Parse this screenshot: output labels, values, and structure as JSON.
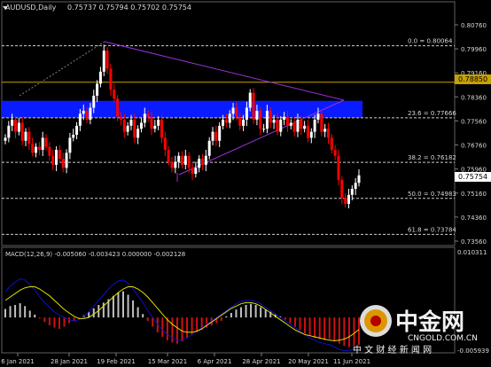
{
  "header": {
    "symbol": "AUDUSD,Daily",
    "ohlc": "0.75737 0.75794 0.75702 0.75754"
  },
  "price_scale": {
    "labels": [
      "0.80760",
      "0.79960",
      "0.79160",
      "0.78360",
      "0.77560",
      "0.76760",
      "0.75960",
      "0.75160",
      "0.74360",
      "0.73560"
    ],
    "highlight_gold": "0.78850",
    "highlight_current": "0.75754"
  },
  "fib_levels": [
    {
      "label": "0.0 = 0.80064",
      "value": 0.80064
    },
    {
      "label": "23.6 = 0.77666",
      "value": 0.77666
    },
    {
      "label": "38.2 = 0.76182",
      "value": 0.76182
    },
    {
      "label": "50.0 = 0.74983",
      "value": 0.74983
    },
    {
      "label": "61.8 = 0.73784",
      "value": 0.73784
    }
  ],
  "macd": {
    "label": "MACD(12,26,9) -0.005060 -0.003423 0.000000 -0.002128",
    "scale_top": "0.010311",
    "scale_bottom": "-0.005939"
  },
  "date_axis": [
    "6 Jan 2021",
    "28 Jan 2021",
    "19 Feb 2021",
    "15 Mar 2021",
    "6 Apr 2021",
    "28 Apr 2021",
    "20 May 2021",
    "11 Jun 2021"
  ],
  "watermark": {
    "brand": "中金网",
    "domain": "CNGOLD.COM.CN",
    "tagline": "中 文 财 经 新 闻 网"
  },
  "colors": {
    "background": "#000000",
    "bull": "#ffffff",
    "bear": "#ff0000",
    "zone": "#0a1cff",
    "triangle": "#9b30d8",
    "gold_line": "#c8a000",
    "macd_hist": "#c0c0c0",
    "macd_hist_neg": "#d01010",
    "macd_line": "#1010c8",
    "signal_line": "#e0e000"
  },
  "chart_data": {
    "type": "candlestick",
    "instrument": "AUDUSD",
    "timeframe": "Daily",
    "last_price": 0.75754,
    "ylim": [
      0.7325,
      0.8105
    ],
    "reference_lines": [
      0.7885,
      0.80064,
      0.77666,
      0.76182,
      0.74983,
      0.73784
    ],
    "zone": [
      0.7766,
      0.7823
    ],
    "closes": [
      0.77,
      0.774,
      0.776,
      0.772,
      0.775,
      0.769,
      0.772,
      0.768,
      0.765,
      0.767,
      0.766,
      0.77,
      0.767,
      0.764,
      0.761,
      0.766,
      0.763,
      0.76,
      0.765,
      0.77,
      0.771,
      0.774,
      0.778,
      0.779,
      0.776,
      0.78,
      0.784,
      0.788,
      0.792,
      0.799,
      0.793,
      0.786,
      0.783,
      0.777,
      0.776,
      0.772,
      0.774,
      0.776,
      0.77,
      0.773,
      0.775,
      0.778,
      0.777,
      0.773,
      0.774,
      0.776,
      0.77,
      0.766,
      0.762,
      0.76,
      0.762,
      0.764,
      0.761,
      0.764,
      0.76,
      0.758,
      0.76,
      0.763,
      0.761,
      0.764,
      0.769,
      0.772,
      0.769,
      0.774,
      0.776,
      0.775,
      0.778,
      0.78,
      0.777,
      0.774,
      0.776,
      0.78,
      0.785,
      0.776,
      0.779,
      0.773,
      0.773,
      0.779,
      0.775,
      0.776,
      0.772,
      0.776,
      0.777,
      0.774,
      0.775,
      0.772,
      0.776,
      0.773,
      0.774,
      0.77,
      0.772,
      0.776,
      0.778,
      0.772,
      0.773,
      0.77,
      0.766,
      0.764,
      0.756,
      0.75,
      0.748,
      0.751,
      0.753,
      0.755,
      0.7575
    ],
    "macd_hist": [
      0.0015,
      0.002,
      0.0022,
      0.0025,
      0.002,
      0.0012,
      0.0005,
      -0.0002,
      -0.0008,
      -0.0014,
      -0.0018,
      -0.002,
      -0.0016,
      -0.001,
      -0.0006,
      -0.0002,
      0.0004,
      0.001,
      0.0016,
      0.0022,
      0.0026,
      0.0032,
      0.0038,
      0.0044,
      0.0046,
      0.004,
      0.003,
      0.0018,
      0.0006,
      -0.0006,
      -0.0016,
      -0.0026,
      -0.0034,
      -0.004,
      -0.0044,
      -0.0046,
      -0.0042,
      -0.0036,
      -0.003,
      -0.0026,
      -0.0022,
      -0.0018,
      -0.0014,
      -0.001,
      -0.0006,
      0.0002,
      0.0008,
      0.0014,
      0.0018,
      0.0022,
      0.0024,
      0.0022,
      0.0018,
      0.0014,
      0.001,
      0.0006,
      0.0002,
      -0.0004,
      -0.001,
      -0.0016,
      -0.0022,
      -0.0028,
      -0.0032,
      -0.0036,
      -0.0038,
      -0.004,
      -0.0038,
      -0.0042,
      -0.0046,
      -0.005,
      -0.0052,
      -0.005,
      -0.0048
    ],
    "macd_line": [
      0.0045,
      0.0055,
      0.0062,
      0.0068,
      0.0066,
      0.0058,
      0.0048,
      0.0036,
      0.0026,
      0.0018,
      0.001,
      0.0004,
      0.0,
      -0.0004,
      -0.0006,
      -0.0004,
      0.0002,
      0.001,
      0.002,
      0.003,
      0.004,
      0.005,
      0.0058,
      0.0064,
      0.0066,
      0.006,
      0.005,
      0.0038,
      0.0026,
      0.0012,
      0.0,
      -0.0012,
      -0.0022,
      -0.003,
      -0.0036,
      -0.004,
      -0.004,
      -0.0036,
      -0.003,
      -0.0024,
      -0.0018,
      -0.0012,
      -0.0006,
      0.0,
      0.0006,
      0.0012,
      0.0018,
      0.0024,
      0.0028,
      0.003,
      0.003,
      0.0028,
      0.0024,
      0.0018,
      0.0012,
      0.0006,
      0.0,
      -0.0006,
      -0.0012,
      -0.0018,
      -0.0024,
      -0.003,
      -0.0036,
      -0.004,
      -0.0044,
      -0.0046,
      -0.0048,
      -0.0052,
      -0.0056,
      -0.0058,
      -0.0058,
      -0.0055,
      -0.0051
    ],
    "signal_line": [
      0.003,
      0.0036,
      0.0042,
      0.0048,
      0.0052,
      0.0054,
      0.0054,
      0.005,
      0.0044,
      0.0038,
      0.003,
      0.0022,
      0.0014,
      0.0008,
      0.0002,
      -0.0002,
      -0.0002,
      0.0,
      0.0006,
      0.0012,
      0.002,
      0.0028,
      0.0036,
      0.0044,
      0.005,
      0.0054,
      0.0054,
      0.005,
      0.0044,
      0.0036,
      0.0026,
      0.0016,
      0.0006,
      -0.0004,
      -0.0012,
      -0.0018,
      -0.0024,
      -0.0026,
      -0.0026,
      -0.0024,
      -0.002,
      -0.0014,
      -0.0008,
      -0.0002,
      0.0004,
      0.001,
      0.0016,
      0.002,
      0.0024,
      0.0026,
      0.0026,
      0.0024,
      0.002,
      0.0014,
      0.0008,
      0.0002,
      -0.0004,
      -0.001,
      -0.0016,
      -0.0022,
      -0.0026,
      -0.003,
      -0.0032,
      -0.0034,
      -0.0036,
      -0.0038,
      -0.004,
      -0.0041,
      -0.004,
      -0.0038,
      -0.0034,
      -0.0028,
      -0.0021
    ]
  }
}
